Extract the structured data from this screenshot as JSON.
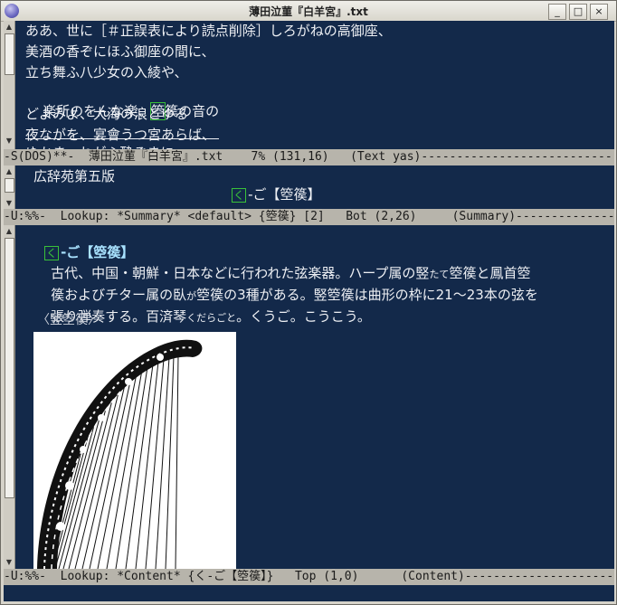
{
  "window": {
    "title": "薄田泣菫『白羊宮』.txt",
    "buttons": [
      "_",
      "□",
      "×"
    ]
  },
  "text_pane": {
    "lines": [
      "ああ、世に［＃正誤表により読点削除］しろがねの高御座、",
      "美酒の香ぞにほふ御座の間に、",
      "立ち舞ふ八少女の入綾や、",
      "楽所のをんな楽、",
      "篌の音の",
      "どよみよ、大海の浪とゆる",
      "夜ながを、宴會うつ宮あらば、",
      "ゆかま、ねがふ酔ぞまに"
    ],
    "highlight_char": "箜",
    "modeline": "-S(DOS)**-  薄田泣菫『白羊宮』.txt    7% (131,16)   (Text yas)-----------------------------------------"
  },
  "summary_pane": {
    "dictionary": "広辞苑第五版",
    "entry_kana": "く",
    "entry_rest": "‐ご【箜篌】",
    "modeline": "-U:%%-  Lookup: *Summary* <default> {箜篌} [2]   Bot (2,26)     (Summary)---------------------------"
  },
  "content_pane": {
    "headword_kana": "く",
    "headword_rest": "‐ご【箜篌】",
    "body_lines": [
      "古代、中国・朝鮮・日本などに行われた弦楽器。ハープ属の竪",
      "箜篌と鳳首箜",
      "篌およびチター属の臥",
      "箜篌の3種がある。竪箜篌は曲形の枠に21〜23本の弦を",
      "張り弾奏する。百済琴",
      "。くうご。こうこう。"
    ],
    "rubies": [
      "たて",
      "が",
      "くだらごと"
    ],
    "figure_label": "〈竪箜篌〉",
    "modeline": "-U:%%-  Lookup: *Content* {く‐ご【箜篌】}   Top (1,0)      (Content)------------------------------"
  },
  "colors": {
    "background": "#13294a",
    "text": "#eef0f4",
    "link_green": "#39c139",
    "modeline": "#b7b4ab"
  }
}
